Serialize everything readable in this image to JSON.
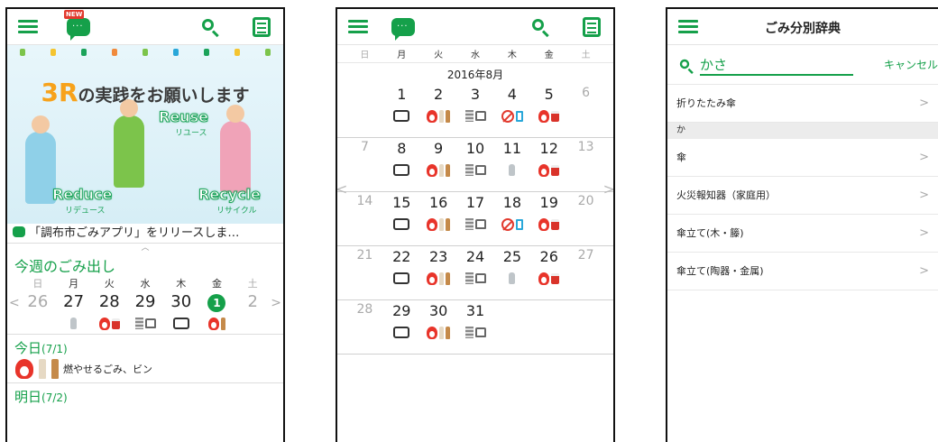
{
  "phone1": {
    "badge_new": "NEW",
    "banner": {
      "title_prefix": "3R",
      "title_rest": "の実践をお願いします",
      "reuse": "Reuse",
      "reuse_jp": "リユース",
      "reduce": "Reduce",
      "reduce_jp": "リデュース",
      "recycle": "Recycle",
      "recycle_jp": "リサイクル"
    },
    "news": "「調布市ごみアプリ」をリリースしま…",
    "week": {
      "title": "今週のごみ出し",
      "weekdays": [
        "日",
        "月",
        "火",
        "水",
        "木",
        "金",
        "土"
      ],
      "dates": [
        "26",
        "27",
        "28",
        "29",
        "30",
        "1",
        "2"
      ],
      "prev": "<",
      "next": ">"
    },
    "today": {
      "label": "今日",
      "date": "(7/1)",
      "desc": "燃やせるごみ、ビン"
    },
    "tomorrow": {
      "label": "明日",
      "date": "(7/2)"
    }
  },
  "phone2": {
    "weekdays": [
      "日",
      "月",
      "火",
      "水",
      "木",
      "金",
      "土"
    ],
    "month": "2016年8月",
    "weeks": [
      [
        "",
        "1",
        "2",
        "3",
        "4",
        "5",
        "6"
      ],
      [
        "7",
        "8",
        "9",
        "10",
        "11",
        "12",
        "13"
      ],
      [
        "14",
        "15",
        "16",
        "17",
        "18",
        "19",
        "20"
      ],
      [
        "21",
        "22",
        "23",
        "24",
        "25",
        "26",
        "27"
      ],
      [
        "28",
        "29",
        "30",
        "31",
        "",
        "",
        ""
      ]
    ],
    "prev": "<",
    "next": ">"
  },
  "phone3": {
    "title": "ごみ分別辞典",
    "search_value": "かさ",
    "cancel": "キャンセル",
    "top_item": "折りたたみ傘",
    "section": "か",
    "items": [
      "傘",
      "火災報知器（家庭用）",
      "傘立て(木・籐)",
      "傘立て(陶器・金属)"
    ],
    "chevron": ">"
  },
  "colors": {
    "accent": "#15a04a",
    "burnable": "#e8342a",
    "bottle": "#c58a4a"
  }
}
